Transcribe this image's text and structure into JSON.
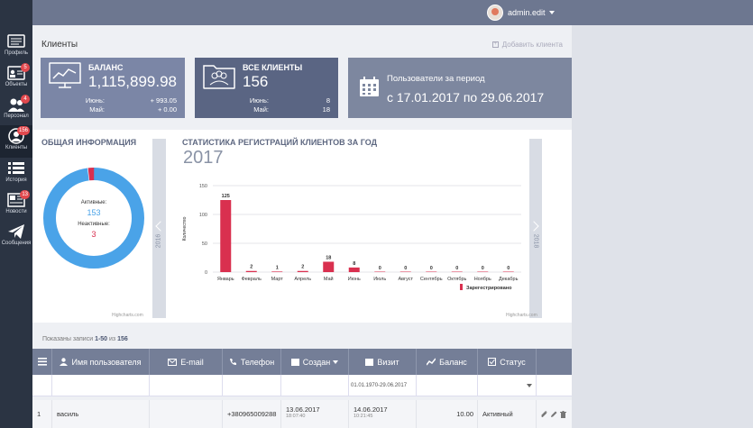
{
  "topbar": {
    "user_name": "admin.edit"
  },
  "sidebar": {
    "items": [
      {
        "label": "Профиль",
        "badge": ""
      },
      {
        "label": "Объекты",
        "badge": "5"
      },
      {
        "label": "Персонал",
        "badge": "4"
      },
      {
        "label": "Клиенты",
        "badge": "156"
      },
      {
        "label": "История",
        "badge": ""
      },
      {
        "label": "Новости",
        "badge": "13"
      },
      {
        "label": "Сообщения",
        "badge": ""
      }
    ]
  },
  "page": {
    "title": "Клиенты",
    "add_client": "Добавить клиента"
  },
  "cards": {
    "balance": {
      "title": "БАЛАНС",
      "value": "1,115,899.98",
      "row1_k": "Июнь:",
      "row1_v": "+ 993.05",
      "row2_k": "Май:",
      "row2_v": "+ 0.00"
    },
    "clients": {
      "title": "ВСЕ КЛИЕНТЫ",
      "value": "156",
      "row1_k": "Июнь:",
      "row1_v": "8",
      "row2_k": "Май:",
      "row2_v": "18"
    },
    "period": {
      "line1": "Пользователи за период",
      "line2": "с 17.01.2017 по 29.06.2017"
    }
  },
  "general": {
    "title": "ОБЩАЯ ИНФОРМАЦИЯ",
    "active_label": "Активные:",
    "active_value": "153",
    "inactive_label": "Неактивные:",
    "inactive_value": "3",
    "credit": "Highcharts.com",
    "colors": {
      "active": "#4aa3e8",
      "inactive": "#d9304f"
    }
  },
  "stats": {
    "title": "СТАТИСТИКА РЕГИСТРАЦИЙ КЛИЕНТОВ ЗА ГОД",
    "year": "2017",
    "prev_year": "2016",
    "next_year": "2018",
    "credit": "Highcharts.com"
  },
  "chart_data": {
    "type": "bar",
    "categories": [
      "Январь",
      "Февраль",
      "Март",
      "Апрель",
      "Май",
      "Июнь",
      "Июль",
      "Август",
      "Сентябрь",
      "Октябрь",
      "Ноябрь",
      "Декабрь"
    ],
    "series": [
      {
        "name": "Зарегестрировано",
        "values": [
          125,
          2,
          1,
          2,
          18,
          8,
          0,
          0,
          0,
          0,
          0,
          0
        ],
        "color": "#d9304f"
      }
    ],
    "ylabel": "Количество",
    "yticks": [
      0,
      50,
      100,
      150
    ],
    "ylim": [
      0,
      150
    ],
    "grid": true,
    "legend": "bottom-right"
  },
  "table": {
    "shown_prefix": "Показаны записи ",
    "shown_range": "1-50",
    "shown_mid": " из ",
    "shown_total": "156",
    "headers": [
      "Имя пользователя",
      "E-mail",
      "Телефон",
      "Создан",
      "Визит",
      "Баланс",
      "Статус"
    ],
    "filter_visit": "01.01.1970-29.06.2017",
    "rows": [
      {
        "num": "1",
        "name": "василь",
        "email": "",
        "phone": "+380965009288",
        "created": "13.06.2017",
        "created_time": "18:07:40",
        "visit": "14.06.2017",
        "visit_time": "10:21:45",
        "balance": "10.00",
        "status": "Активный"
      }
    ]
  }
}
